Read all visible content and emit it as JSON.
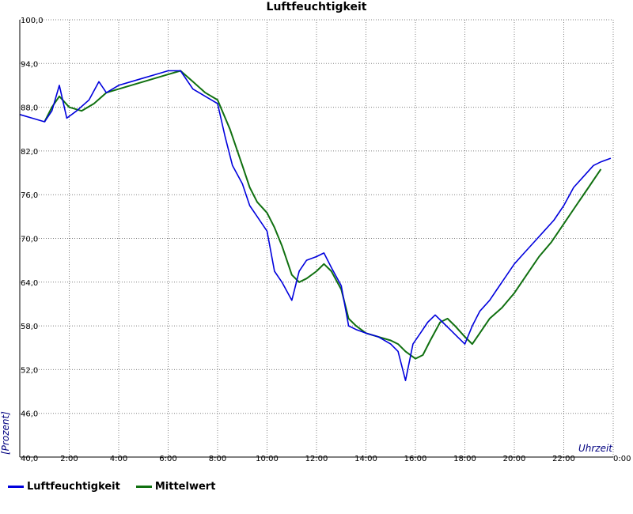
{
  "colors": {
    "series_raw": "#0000dd",
    "series_mean": "#107010",
    "grid": "#808080",
    "axis_label": "#000080"
  },
  "chart_data": {
    "type": "line",
    "title": "Luftfeuchtigkeit",
    "ylabel": "[Prozent]",
    "xlabel": "Uhrzeit",
    "ylim": [
      40,
      100
    ],
    "xlim": [
      0,
      24
    ],
    "yticks": [
      "100,0",
      "94,0",
      "88,0",
      "82,0",
      "76,0",
      "70,0",
      "64,0",
      "58,0",
      "52,0",
      "46,0",
      "40,0"
    ],
    "xticks": [
      "2:00",
      "4:00",
      "6:00",
      "8:00",
      "10:00",
      "12:00",
      "14:00",
      "16:00",
      "18:00",
      "20:00",
      "22:00",
      "0:00"
    ],
    "grid": true,
    "legend_position": "bottom-left",
    "series": [
      {
        "name": "Luftfeuchtigkeit",
        "x": [
          0,
          0.5,
          1.0,
          1.3,
          1.6,
          1.9,
          2.3,
          2.8,
          3.2,
          3.5,
          4.0,
          4.5,
          5.0,
          5.5,
          6.0,
          6.5,
          7.0,
          7.5,
          8.0,
          8.3,
          8.6,
          9.0,
          9.3,
          9.6,
          10.0,
          10.3,
          10.6,
          11.0,
          11.3,
          11.6,
          12.0,
          12.3,
          12.6,
          13.0,
          13.3,
          13.6,
          14.0,
          14.5,
          15.0,
          15.3,
          15.6,
          15.9,
          16.2,
          16.5,
          16.8,
          17.1,
          17.4,
          17.7,
          18.0,
          18.3,
          18.6,
          19.0,
          19.3,
          19.6,
          20.0,
          20.4,
          20.8,
          21.2,
          21.6,
          22.0,
          22.4,
          22.8,
          23.2,
          23.5,
          23.9
        ],
        "y": [
          87.0,
          86.5,
          86.0,
          87.5,
          91.0,
          86.5,
          87.5,
          89.0,
          91.5,
          90.0,
          91.0,
          91.5,
          92.0,
          92.5,
          93.0,
          93.0,
          90.5,
          89.5,
          88.5,
          84.0,
          80.0,
          77.5,
          74.5,
          73.0,
          71.0,
          65.5,
          64.0,
          61.5,
          65.5,
          67.0,
          67.5,
          68.0,
          66.0,
          63.5,
          58.0,
          57.5,
          57.0,
          56.5,
          55.5,
          54.5,
          50.5,
          55.5,
          57.0,
          58.5,
          59.5,
          58.5,
          57.5,
          56.5,
          55.5,
          58.0,
          60.0,
          61.5,
          63.0,
          64.5,
          66.5,
          68.0,
          69.5,
          71.0,
          72.5,
          74.5,
          77.0,
          78.5,
          80.0,
          80.5,
          81.0
        ]
      },
      {
        "name": "Mittelwert",
        "x": [
          1.0,
          1.3,
          1.6,
          2.0,
          2.5,
          3.0,
          3.5,
          4.0,
          4.5,
          5.0,
          5.5,
          6.0,
          6.5,
          7.0,
          7.5,
          8.0,
          8.5,
          9.0,
          9.3,
          9.6,
          10.0,
          10.3,
          10.6,
          11.0,
          11.3,
          11.6,
          12.0,
          12.3,
          12.6,
          13.0,
          13.3,
          13.6,
          14.0,
          14.5,
          15.0,
          15.3,
          15.6,
          16.0,
          16.3,
          16.6,
          17.0,
          17.3,
          17.6,
          18.0,
          18.3,
          18.6,
          19.0,
          19.5,
          20.0,
          20.5,
          21.0,
          21.5,
          22.0,
          22.5,
          23.0,
          23.5
        ],
        "y": [
          86.0,
          88.0,
          89.5,
          88.0,
          87.5,
          88.5,
          90.0,
          90.5,
          91.0,
          91.5,
          92.0,
          92.5,
          93.0,
          91.5,
          90.0,
          89.0,
          85.0,
          80.0,
          77.0,
          75.0,
          73.5,
          71.5,
          69.0,
          65.0,
          64.0,
          64.5,
          65.5,
          66.5,
          65.5,
          63.0,
          59.0,
          58.0,
          57.0,
          56.5,
          56.0,
          55.5,
          54.5,
          53.5,
          54.0,
          56.0,
          58.5,
          59.0,
          58.0,
          56.5,
          55.5,
          57.0,
          59.0,
          60.5,
          62.5,
          65.0,
          67.5,
          69.5,
          72.0,
          74.5,
          77.0,
          79.5
        ]
      }
    ]
  }
}
